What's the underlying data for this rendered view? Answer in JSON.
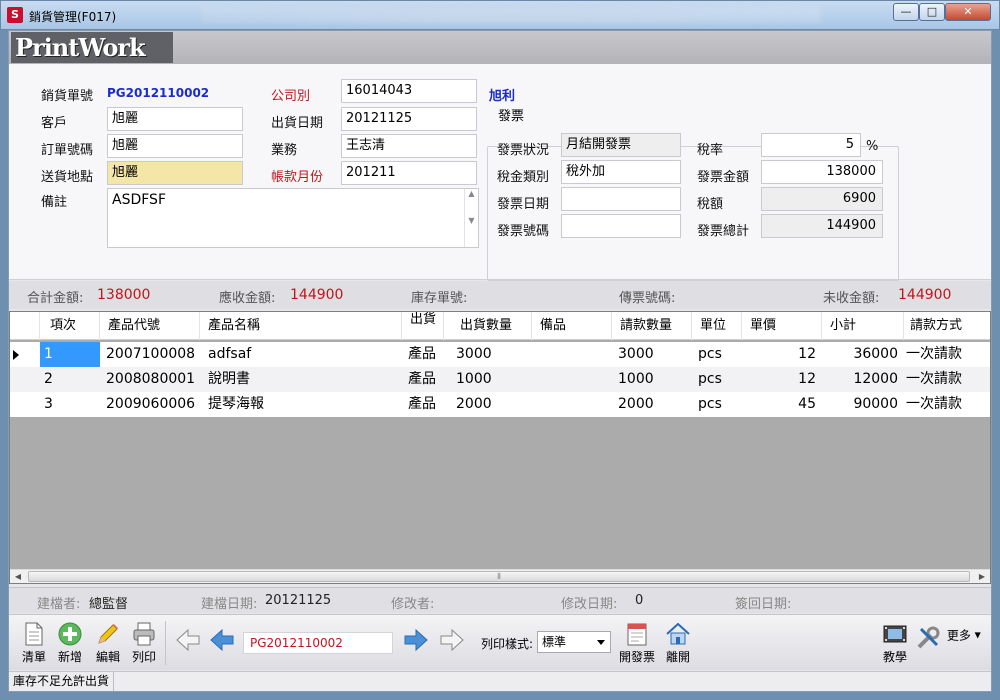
{
  "window": {
    "title": "銷貨管理(F017)",
    "brand": "PrintWork",
    "icon": "app-logo-icon"
  },
  "form": {
    "order_no_label": "銷貨單號",
    "order_no": "PG2012110002",
    "customer_label": "客戶",
    "customer": "旭麗",
    "po_label": "訂單號碼",
    "po": "旭麗",
    "ship_to_label": "送貨地點",
    "ship_to": "旭麗",
    "memo_label": "備註",
    "memo": "ASDFSF",
    "company_label": "公司別",
    "company_code": "16014043",
    "company_name": "旭利",
    "ship_date_label": "出貨日期",
    "ship_date": "20121125",
    "sales_label": "業務",
    "sales": "王志清",
    "account_month_label": "帳款月份",
    "account_month": "201211"
  },
  "invoice": {
    "group_title": "發票",
    "status_label": "發票狀況",
    "status": "月結開發票",
    "tax_type_label": "稅金類別",
    "tax_type": "稅外加",
    "date_label": "發票日期",
    "date": "",
    "number_label": "發票號碼",
    "number": "",
    "tax_rate_label": "稅率",
    "tax_rate": "5",
    "tax_rate_unit": "%",
    "amount_label": "發票金額",
    "amount": "138000",
    "tax_label": "稅額",
    "tax": "6900",
    "total_label": "發票總計",
    "total": "144900"
  },
  "summary": {
    "total_label": "合計金額:",
    "total": "138000",
    "receivable_label": "應收金額:",
    "receivable": "144900",
    "stock_no_label": "庫存單號:",
    "stock_no": "",
    "voucher_label": "傳票號碼:",
    "voucher": "",
    "outstanding_label": "未收金額:",
    "outstanding": "144900"
  },
  "grid": {
    "columns": [
      "項次",
      "產品代號",
      "產品名稱",
      "出貨",
      "出貨數量",
      "備品",
      "請款數量",
      "單位",
      "單價",
      "小計",
      "請款方式"
    ],
    "rows": [
      {
        "no": "1",
        "code": "2007100008",
        "name": "adfsaf",
        "type": "產品",
        "qty": "3000",
        "spare": "",
        "bill_qty": "3000",
        "unit": "pcs",
        "price": "12",
        "subtotal": "36000",
        "method": "一次請款"
      },
      {
        "no": "2",
        "code": "2008080001",
        "name": "說明書",
        "type": "產品",
        "qty": "1000",
        "spare": "",
        "bill_qty": "1000",
        "unit": "pcs",
        "price": "12",
        "subtotal": "12000",
        "method": "一次請款"
      },
      {
        "no": "3",
        "code": "2009060006",
        "name": "提琴海報",
        "type": "產品",
        "qty": "2000",
        "spare": "",
        "bill_qty": "2000",
        "unit": "pcs",
        "price": "45",
        "subtotal": "90000",
        "method": "一次請款"
      }
    ]
  },
  "audit": {
    "creator_label": "建檔者:",
    "creator": "總監督",
    "created_label": "建檔日期:",
    "created": "20121125",
    "modifier_label": "修改者:",
    "modifier": "",
    "modified_label": "修改日期:",
    "modified": "0",
    "returned_label": "簽回日期:",
    "returned": ""
  },
  "toolbar": {
    "list": "清單",
    "add": "新增",
    "edit": "編輯",
    "print": "列印",
    "current_record": "PG2012110002",
    "print_style_label": "列印樣式:",
    "print_style": "標準",
    "invoice": "開發票",
    "exit": "離開",
    "tutorial": "教學",
    "more": "更多"
  },
  "status_bar": {
    "message": "庫存不足允許出貨"
  },
  "colors": {
    "accent_red": "#c0161a",
    "link_blue": "#1a2bd0",
    "selection": "#3399ff",
    "highlight_yellow": "#f3e6a6"
  }
}
